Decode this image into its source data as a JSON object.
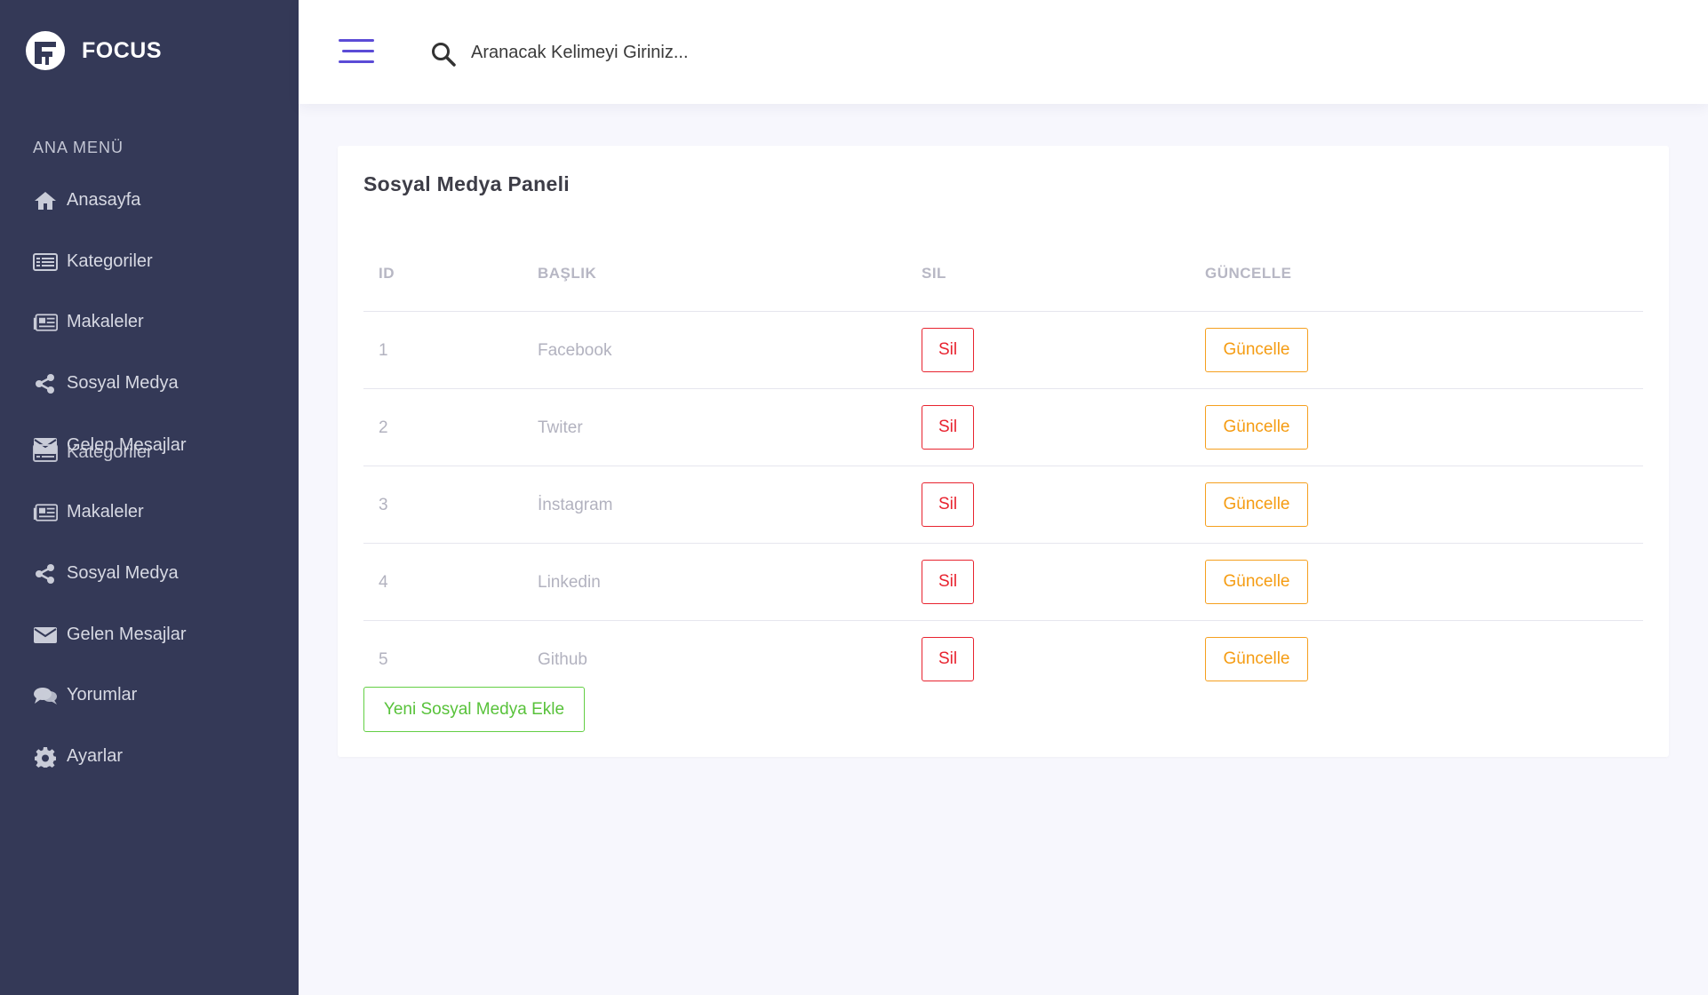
{
  "brand": {
    "name": "FOCUS"
  },
  "sidebar": {
    "section_title": "ANA MENÜ",
    "items": [
      {
        "label": "Anasayfa",
        "icon": "home-icon"
      },
      {
        "label": "Kategoriler",
        "icon": "list-icon"
      },
      {
        "label": "Makaleler",
        "icon": "newspaper-icon"
      },
      {
        "label": "Sosyal Medya",
        "icon": "share-icon"
      },
      {
        "label": "Gelen Mesajlar",
        "icon": "envelope-icon"
      },
      {
        "label": "Kategoriler",
        "icon": "list-icon"
      },
      {
        "label": "Makaleler",
        "icon": "newspaper-icon"
      },
      {
        "label": "Sosyal Medya",
        "icon": "share-icon"
      },
      {
        "label": "Gelen Mesajlar",
        "icon": "envelope-icon"
      },
      {
        "label": "Yorumlar",
        "icon": "comments-icon"
      },
      {
        "label": "Ayarlar",
        "icon": "gear-icon"
      }
    ]
  },
  "header": {
    "search_placeholder": "Aranacak Kelimeyi Giriniz..."
  },
  "panel": {
    "title": "Sosyal Medya Paneli",
    "columns": [
      "ID",
      "BAŞLIK",
      "SIL",
      "GÜNCELLE"
    ],
    "rows": [
      {
        "id": "1",
        "title": "Facebook",
        "delete_label": "Sil",
        "update_label": "Güncelle"
      },
      {
        "id": "2",
        "title": "Twiter",
        "delete_label": "Sil",
        "update_label": "Güncelle"
      },
      {
        "id": "3",
        "title": "İnstagram",
        "delete_label": "Sil",
        "update_label": "Güncelle"
      },
      {
        "id": "4",
        "title": "Linkedin",
        "delete_label": "Sil",
        "update_label": "Güncelle"
      },
      {
        "id": "5",
        "title": "Github",
        "delete_label": "Sil",
        "update_label": "Güncelle"
      }
    ],
    "add_button_label": "Yeni Sosyal Medya Ekle"
  },
  "colors": {
    "sidebar_bg": "#343957",
    "accent": "#5b4bd6",
    "danger": "#e8232f",
    "warning": "#f59c12",
    "success": "#58c23a"
  }
}
